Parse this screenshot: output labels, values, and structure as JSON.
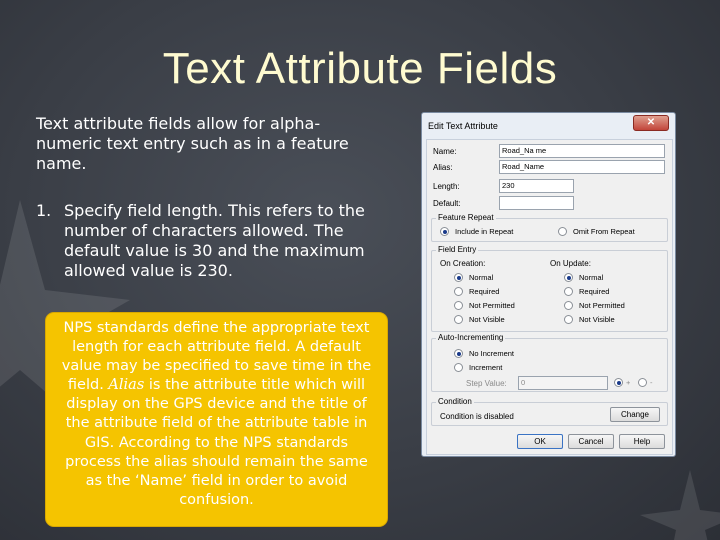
{
  "slide": {
    "title": "Text Attribute Fields",
    "intro": "Text attribute fields allow for alpha-numeric text entry such as in a  feature name.",
    "steps": [
      {
        "num": "1.",
        "text": "Specify field length. This refers to  the number of characters allowed.  The default value is 30 and the maximum allowed value is 230."
      }
    ],
    "note_before_em": "NPS standards define the appropriate text length for each attribute field. A default value may be specified to save time in the field. ",
    "note_em": "Alias",
    "note_after_em": " is the attribute title which will display on the GPS device and the title of the attribute field of the attribute table in GIS. According to the NPS standards process the alias should remain the same as the ‘Name’ field in order to avoid confusion."
  },
  "dialog": {
    "title": "Edit Text Attribute",
    "close": "✕",
    "labels": {
      "name": "Name:",
      "alias": "Alias:",
      "length": "Length:",
      "default": "Default:"
    },
    "values": {
      "name": "Road_Na me",
      "alias": "Road_Name",
      "length": "230",
      "default": ""
    },
    "feature_repeat": {
      "title": "Feature Repeat",
      "include": "Include in Repeat",
      "omit": "Omit From Repeat"
    },
    "field_entry": {
      "title": "Field Entry",
      "on_creation": "On Creation:",
      "on_update": "On Update:",
      "options": [
        "Normal",
        "Required",
        "Not Permitted",
        "Not Visible"
      ]
    },
    "auto_inc": {
      "title": "Auto-Incrementing",
      "no": "No Increment",
      "inc": "Increment",
      "step_label": "Step Value:",
      "step_value": "0",
      "plus": "+",
      "minus": "-"
    },
    "condition": {
      "title": "Condition",
      "text": "Condition is disabled",
      "change": "Change"
    },
    "buttons": {
      "ok": "OK",
      "cancel": "Cancel",
      "help": "Help"
    }
  }
}
